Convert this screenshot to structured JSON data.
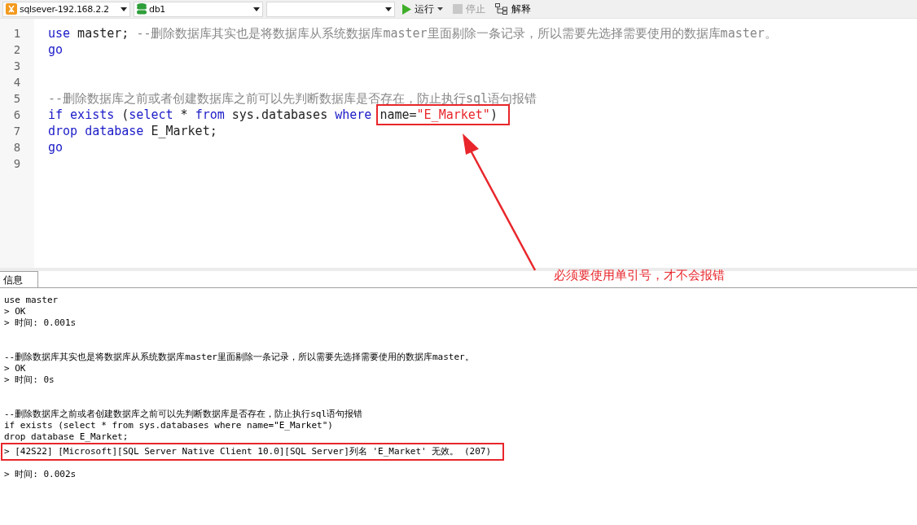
{
  "toolbar": {
    "connection": {
      "value": "sqlsever-192.168.2.2"
    },
    "database": {
      "value": "db1"
    },
    "buttons": [
      {
        "kind": "run",
        "label": "运行",
        "disabled": false
      },
      {
        "kind": "stop",
        "label": "停止",
        "disabled": true
      },
      {
        "kind": "explain",
        "label": "解释",
        "disabled": false
      }
    ]
  },
  "editor": {
    "lines": [
      {
        "number": "1",
        "tokens": [
          {
            "kind": "keyword",
            "text": "use"
          },
          {
            "kind": "plain",
            "text": " master; "
          },
          {
            "kind": "comment",
            "text": "--删除数据库其实也是将数据库从系统数据库master里面剔除一条记录，所以需要先选择需要使用的数据库master。"
          }
        ]
      },
      {
        "number": "2",
        "tokens": [
          {
            "kind": "keyword",
            "text": "go"
          }
        ]
      },
      {
        "number": "3"
      },
      {
        "number": "4"
      },
      {
        "number": "5",
        "tokens": [
          {
            "kind": "comment",
            "text": "--删除数据库之前或者创建数据库之前可以先判断数据库是否存在，防止执行sql语句报错"
          }
        ]
      },
      {
        "number": "6",
        "tokens": [
          {
            "kind": "keyword",
            "text": "if exists"
          },
          {
            "kind": "plain",
            "text": " ("
          },
          {
            "kind": "keyword",
            "text": "select"
          },
          {
            "kind": "plain",
            "text": " * "
          },
          {
            "kind": "keyword",
            "text": "from"
          },
          {
            "kind": "plain",
            "text": " sys.databases "
          },
          {
            "kind": "keyword",
            "text": "where "
          },
          {
            "kind": "plain",
            "text": "name=",
            "highlight": true
          },
          {
            "kind": "string",
            "text": "\"E_Market\"",
            "highlight": true
          },
          {
            "kind": "plain",
            "text": ")",
            "highlight": true
          }
        ]
      },
      {
        "number": "7",
        "tokens": [
          {
            "kind": "keyword",
            "text": "drop database"
          },
          {
            "kind": "plain",
            "text": " E_Market;"
          }
        ]
      },
      {
        "number": "8",
        "tokens": [
          {
            "kind": "keyword",
            "text": "go"
          }
        ]
      },
      {
        "number": "9"
      }
    ]
  },
  "annotation": {
    "text": "必须要使用单引号，才不会报错"
  },
  "messages": {
    "tabs": [
      {
        "label": "信息",
        "selected": true
      }
    ],
    "blocks": [
      {
        "lines": [
          {
            "kind": "plain",
            "text": "use master"
          },
          {
            "kind": "plain",
            "text": "> OK"
          },
          {
            "kind": "plain",
            "text": "> 时间: 0.001s"
          }
        ]
      },
      {
        "lines": [
          {
            "kind": "plain",
            "text": "--删除数据库其实也是将数据库从系统数据库master里面剔除一条记录，所以需要先选择需要使用的数据库master。"
          },
          {
            "kind": "plain",
            "text": "> OK"
          },
          {
            "kind": "plain",
            "text": "> 时间: 0s"
          }
        ]
      },
      {
        "lines": [
          {
            "kind": "plain",
            "text": "--删除数据库之前或者创建数据库之前可以先判断数据库是否存在，防止执行sql语句报错"
          },
          {
            "kind": "plain",
            "text": "if exists (select * from sys.databases where name=\"E_Market\")"
          },
          {
            "kind": "plain",
            "text": "drop database E_Market;"
          },
          {
            "kind": "error",
            "text": "> [42S22] [Microsoft][SQL Server Native Client 10.0][SQL Server]列名 'E_Market' 无效。 (207)"
          },
          {
            "kind": "plain",
            "text": "> 时间: 0.002s"
          }
        ]
      }
    ]
  }
}
